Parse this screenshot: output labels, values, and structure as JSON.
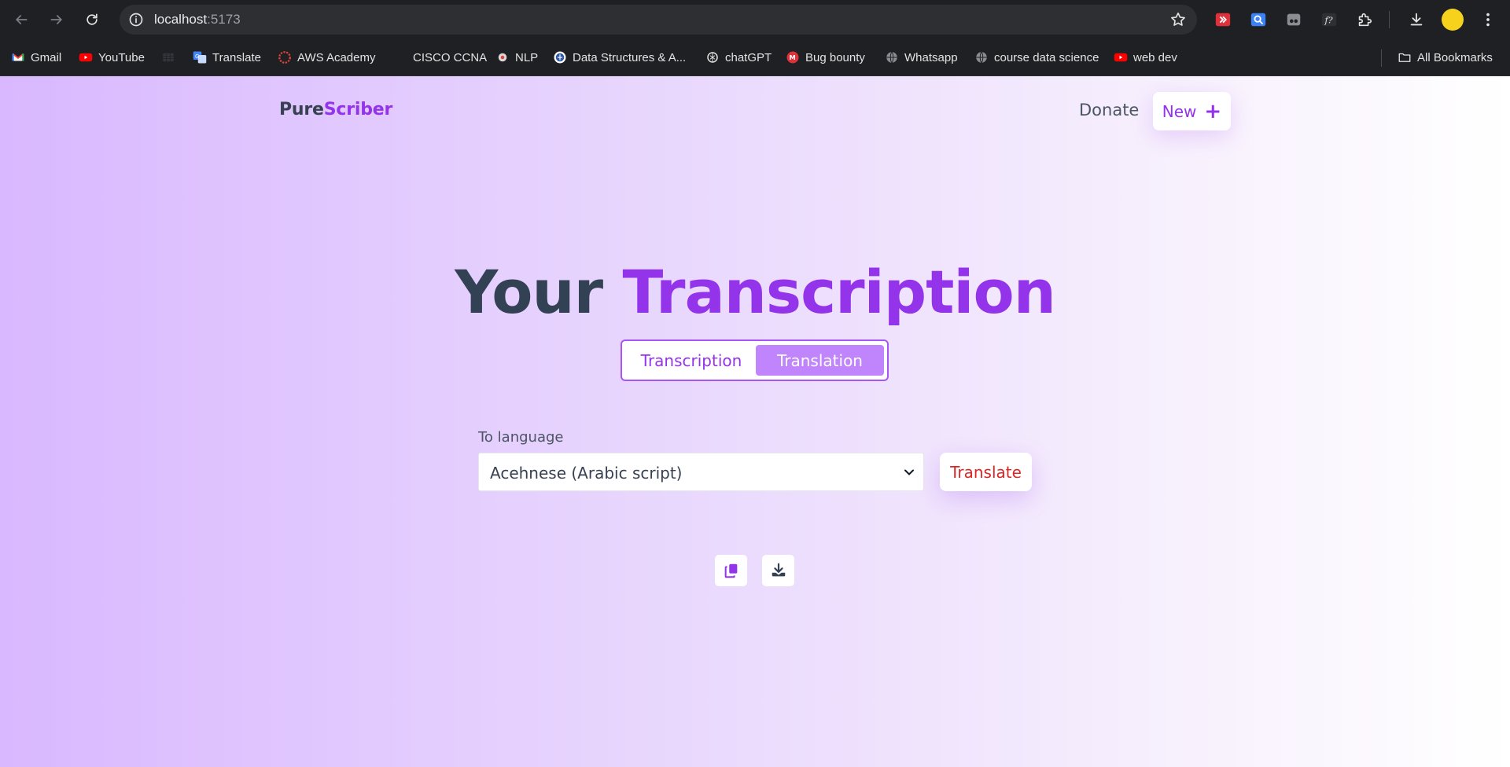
{
  "browser": {
    "url_host": "localhost",
    "url_port": ":5173",
    "bookmarks": [
      {
        "label": "Gmail",
        "icon": "gmail-icon"
      },
      {
        "label": "YouTube",
        "icon": "youtube-icon"
      },
      {
        "label": "",
        "icon": "grid-icon"
      },
      {
        "label": "Translate",
        "icon": "translate-icon"
      },
      {
        "label": "AWS Academy",
        "icon": "aws-academy-icon"
      },
      {
        "label": "CISCO CCNA",
        "icon": "cisco-icon"
      },
      {
        "label": "NLP",
        "icon": "nlp-icon"
      },
      {
        "label": "Data Structures & A...",
        "icon": "data-structures-icon"
      },
      {
        "label": "chatGPT",
        "icon": "chatgpt-icon"
      },
      {
        "label": "Bug bounty",
        "icon": "bug-bounty-icon"
      },
      {
        "label": "Whatsapp",
        "icon": "globe-icon"
      },
      {
        "label": "course data science",
        "icon": "globe-icon"
      },
      {
        "label": "web dev",
        "icon": "youtube-icon"
      }
    ],
    "all_bookmarks_label": "All Bookmarks"
  },
  "app": {
    "logo_part1": "Pure",
    "logo_part2": "Scriber",
    "donate_label": "Donate",
    "new_label": "New",
    "new_icon": "plus-icon",
    "title_part1": "Your",
    "title_part2": "Transcription",
    "tabs": [
      {
        "label": "Transcription",
        "active": false
      },
      {
        "label": "Translation",
        "active": true
      }
    ],
    "to_language_label": "To language",
    "selected_language": "Acehnese (Arabic script)",
    "translate_label": "Translate",
    "actions": [
      {
        "icon": "copy-icon"
      },
      {
        "icon": "download-icon"
      }
    ],
    "colors": {
      "accent": "#9333ea",
      "active_tab": "#c084fc",
      "translate_text": "#dc2626",
      "heading_dark": "#334155"
    }
  }
}
